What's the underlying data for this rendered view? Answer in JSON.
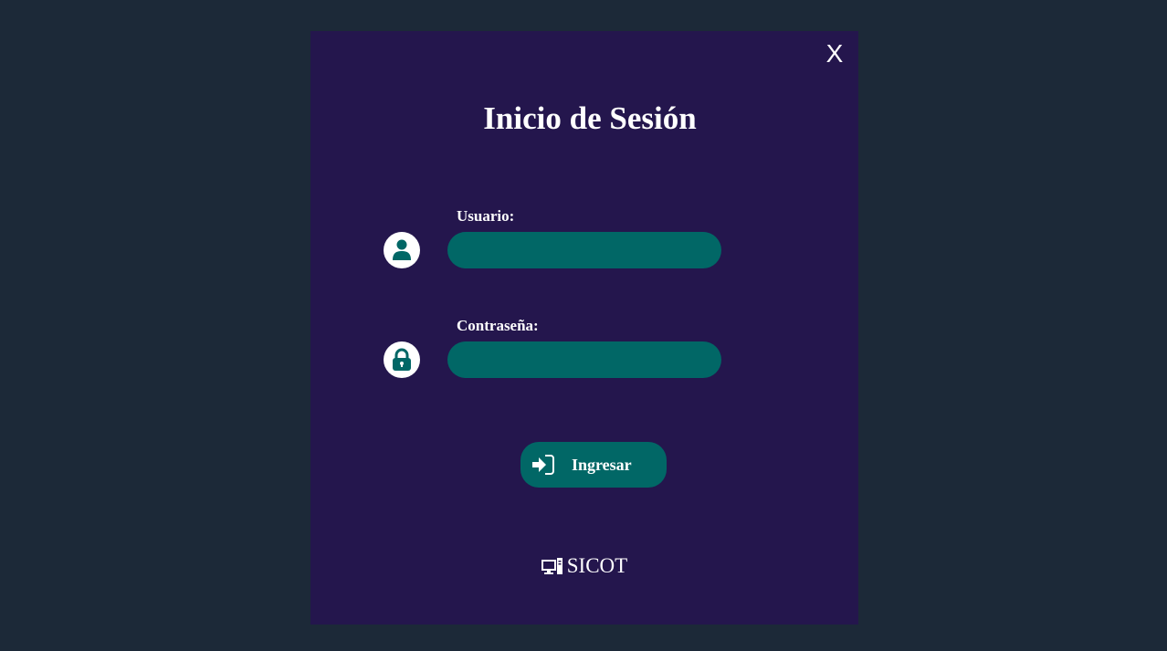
{
  "dialog": {
    "close_label": "X",
    "title": "Inicio de Sesión"
  },
  "fields": {
    "username": {
      "label": "Usuario:",
      "value": "",
      "icon": "user-icon"
    },
    "password": {
      "label": "Contraseña:",
      "value": "",
      "icon": "lock-icon"
    }
  },
  "submit": {
    "label": "Ingresar",
    "icon": "sign-in-icon"
  },
  "brand": {
    "name": "SICOT",
    "icon": "desktop-computer-icon"
  },
  "colors": {
    "page_background": "#1c2938",
    "panel_background": "#24164d",
    "accent": "#016766",
    "text": "#ffffff"
  }
}
